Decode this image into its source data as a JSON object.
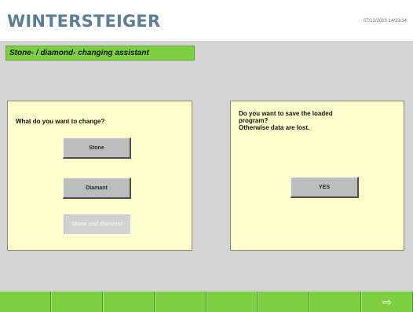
{
  "header": {
    "logo_text": "WINTERSTEIGER",
    "datetime": "07/12/2010 14/33/14"
  },
  "title": "Stone- / diamond- changing assistant",
  "left_panel": {
    "question": "What do you want to change?",
    "buttons": [
      {
        "label": "Stone",
        "state": "enabled"
      },
      {
        "label": "Diamant",
        "state": "enabled"
      },
      {
        "label": "Stone and diamond",
        "state": "disabled"
      }
    ]
  },
  "right_panel": {
    "lines": [
      "Do you want to save the loaded",
      "program?",
      "Otherwise data are lost."
    ],
    "yes_label": "YES"
  },
  "footer": {
    "keys": [
      "",
      "",
      "",
      "",
      "",
      "",
      "",
      ""
    ],
    "next_icon": "arrow-right-icon"
  },
  "colors": {
    "brand_green": "#7ed043",
    "panel_bg": "#ffffcc",
    "logo_blue": "#5a7f97"
  }
}
